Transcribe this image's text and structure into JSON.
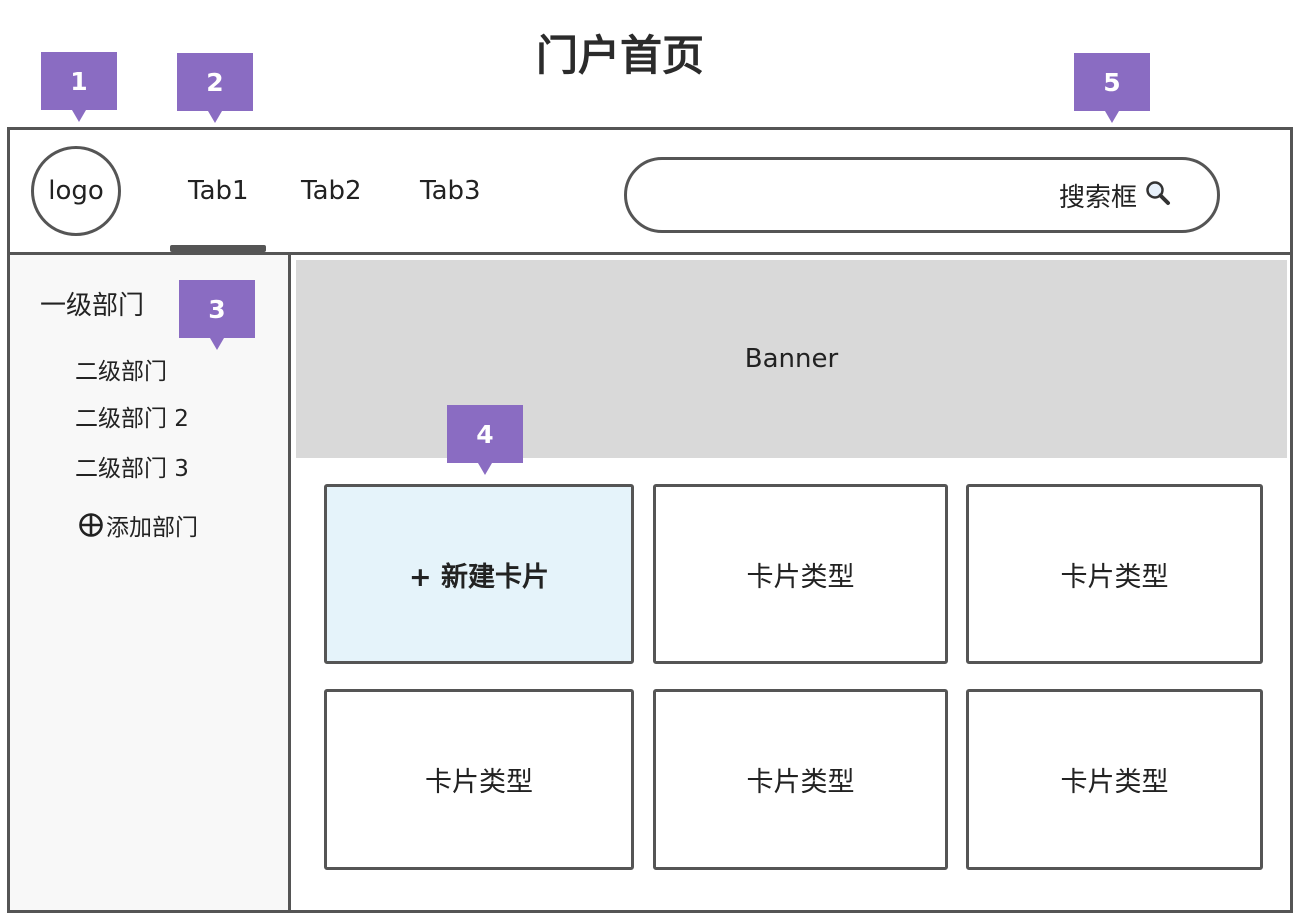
{
  "page_title": "门户首页",
  "header": {
    "logo_label": "logo",
    "tabs": [
      {
        "label": "Tab1",
        "active": true
      },
      {
        "label": "Tab2",
        "active": false
      },
      {
        "label": "Tab3",
        "active": false
      }
    ],
    "search_label": "搜索框"
  },
  "sidebar": {
    "level1": "一级部门",
    "level2_items": [
      "二级部门",
      "二级部门 2",
      "二级部门 3"
    ],
    "add_label": "添加部门"
  },
  "main": {
    "banner_label": "Banner",
    "new_card_label": "+ 新建卡片",
    "card_label": "卡片类型"
  },
  "markers": [
    "1",
    "2",
    "3",
    "4",
    "5"
  ],
  "colors": {
    "marker": "#8a6cc2",
    "banner": "#d9d9d9",
    "new_card": "#e5f3fa",
    "border": "#555555",
    "sidebar_bg": "#f8f8f8"
  }
}
